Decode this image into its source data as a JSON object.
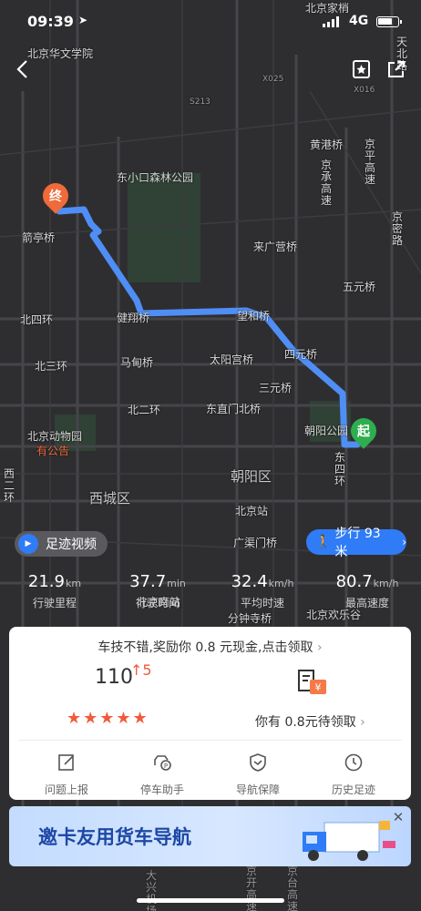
{
  "status_bar": {
    "time": "09:39",
    "network": "4G",
    "location_icon": "location-arrow-icon",
    "signal_icon": "signal-icon",
    "battery_icon": "battery-icon"
  },
  "header": {
    "back_icon": "chevron-left-icon",
    "bookmark_icon": "bookmark-icon",
    "share_icon": "share-icon"
  },
  "map": {
    "labels": [
      {
        "id": "l1",
        "text": "北京华文学院"
      },
      {
        "id": "l2",
        "text": "北京家梢"
      },
      {
        "id": "l3",
        "text": "东小口森林公园"
      },
      {
        "id": "l4",
        "text": "黄港桥"
      },
      {
        "id": "l5",
        "text": "京承高速"
      },
      {
        "id": "l6",
        "text": "京平高速"
      },
      {
        "id": "l7",
        "text": "天北路"
      },
      {
        "id": "l8",
        "text": "箭亭桥"
      },
      {
        "id": "l9",
        "text": "来广营桥"
      },
      {
        "id": "l10",
        "text": "京密路"
      },
      {
        "id": "l11",
        "text": "五元桥"
      },
      {
        "id": "l12",
        "text": "北四环"
      },
      {
        "id": "l13",
        "text": "健翔桥"
      },
      {
        "id": "l14",
        "text": "望和桥"
      },
      {
        "id": "l15",
        "text": "北三环"
      },
      {
        "id": "l16",
        "text": "马甸桥"
      },
      {
        "id": "l17",
        "text": "太阳宫桥"
      },
      {
        "id": "l18",
        "text": "四元桥"
      },
      {
        "id": "l19",
        "text": "三元桥"
      },
      {
        "id": "l20",
        "text": "北二环"
      },
      {
        "id": "l21",
        "text": "东直门北桥"
      },
      {
        "id": "l22",
        "text": "朝阳公园"
      },
      {
        "id": "l23",
        "text": "北京动物园"
      },
      {
        "id": "l24",
        "text": "有公告"
      },
      {
        "id": "l25",
        "text": "西二环"
      },
      {
        "id": "l26",
        "text": "西城区"
      },
      {
        "id": "l27",
        "text": "朝阳区"
      },
      {
        "id": "l28",
        "text": "东四环"
      },
      {
        "id": "l29",
        "text": "北京站"
      },
      {
        "id": "l30",
        "text": "广渠门桥"
      },
      {
        "id": "l31",
        "text": "北京南站"
      },
      {
        "id": "l32",
        "text": "分钟寺桥"
      },
      {
        "id": "l33",
        "text": "北京欢乐谷"
      },
      {
        "id": "l34",
        "text": "X025"
      },
      {
        "id": "l35",
        "text": "X016"
      },
      {
        "id": "l36",
        "text": "S213"
      },
      {
        "id": "l37",
        "text": "京开高速"
      },
      {
        "id": "l38",
        "text": "京台高速"
      },
      {
        "id": "l39",
        "text": "大兴机场"
      }
    ],
    "end_marker": "终",
    "start_marker": "起"
  },
  "pills": {
    "video_label": "足迹视频",
    "walk_label": "步行 93 米"
  },
  "stats": [
    {
      "value": "21.9",
      "unit": "km",
      "label": "行驶里程"
    },
    {
      "value": "37.7",
      "unit": "min",
      "label": "行驶时间"
    },
    {
      "value": "32.4",
      "unit": "km/h",
      "label": "平均时速"
    },
    {
      "value": "80.7",
      "unit": "km/h",
      "label": "最高速度"
    }
  ],
  "card": {
    "banner": "车技不错,奖励你 0.8 元现金,点击领取",
    "score": "110",
    "score_change": "5",
    "stars": "★★★★★",
    "rating_stars": 5,
    "reward_text": "你有 0.8元待领取",
    "actions": [
      {
        "label": "问题上报",
        "icon": "edit-icon"
      },
      {
        "label": "停车助手",
        "icon": "parking-icon"
      },
      {
        "label": "导航保障",
        "icon": "shield-icon"
      },
      {
        "label": "历史足迹",
        "icon": "clock-icon"
      }
    ]
  },
  "ad": {
    "text": "邀卡友用货车导航",
    "close_icon": "close-icon"
  }
}
